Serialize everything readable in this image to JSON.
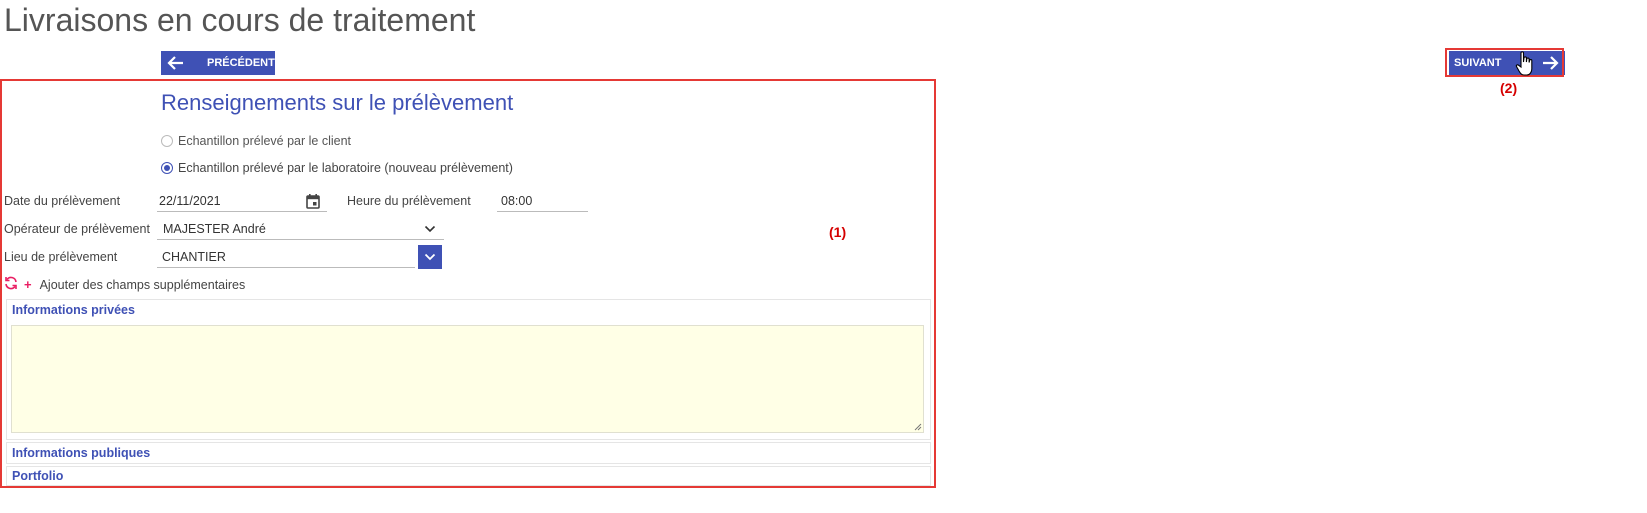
{
  "page": {
    "title": "Livraisons en cours de traitement"
  },
  "nav": {
    "prev_label": "PRÉCÉDENT",
    "next_label": "SUIVANT"
  },
  "annotations": {
    "panel": "(1)",
    "next": "(2)"
  },
  "section": {
    "title": "Renseignements sur le prélèvement"
  },
  "sample_options": [
    {
      "label": "Echantillon prélevé par le client",
      "checked": false
    },
    {
      "label": "Echantillon prélevé par le laboratoire (nouveau prélèvement)",
      "checked": true
    }
  ],
  "form": {
    "date_label": "Date du prélèvement",
    "date_value": "22/11/2021",
    "time_label": "Heure du prélèvement",
    "time_value": "08:00",
    "operator_label": "Opérateur de prélèvement",
    "operator_value": "MAJESTER André",
    "place_label": "Lieu de prélèvement",
    "place_value": "CHANTIER",
    "add_fields_plus": "+",
    "add_fields_label": "Ajouter des champs supplémentaires"
  },
  "accordions": {
    "private_title": "Informations privées",
    "public_title": "Informations publiques",
    "portfolio_title": "Portfolio"
  },
  "colors": {
    "accent": "#3f51b5",
    "highlight": "#e53935",
    "annotation": "#d50000",
    "textarea_bg": "#ffffe6",
    "add_icon": "#e91e63"
  },
  "icons": [
    "arrow-left-icon",
    "arrow-right-icon",
    "hand-cursor-icon",
    "calendar-icon",
    "chevron-down-icon",
    "refresh-icon",
    "resize-grip-icon"
  ]
}
